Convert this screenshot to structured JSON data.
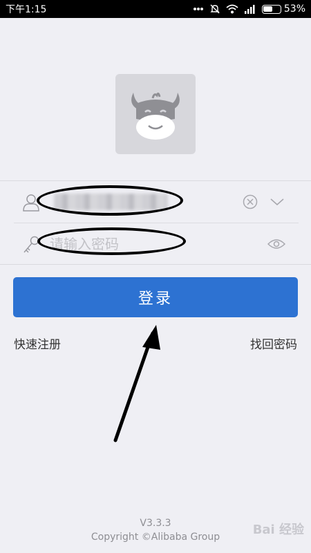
{
  "status_bar": {
    "time": "下午1:15",
    "battery_text": "53%",
    "battery_level": 0.53,
    "icons": [
      "signal-dots-icon",
      "mute-icon",
      "wifi-icon",
      "cellular-signal-icon",
      "battery-icon"
    ]
  },
  "logo": {
    "icon": "cow-logo-icon"
  },
  "login_form": {
    "account_icon": "user-icon",
    "account_value_obscured": true,
    "clear_icon": "clear-circle-icon",
    "dropdown_icon": "chevron-down-icon",
    "password_icon": "key-icon",
    "password_placeholder": "请输入密码",
    "password_value": "",
    "visibility_icon": "eye-icon",
    "login_button_label": "登录",
    "login_button_color": "#2d72d2"
  },
  "links": {
    "register": "快速注册",
    "forgot_password": "找回密码"
  },
  "footer": {
    "version": "V3.3.3",
    "copyright": "Copyright ©Alibaba Group"
  },
  "watermark": "Bai 经验"
}
